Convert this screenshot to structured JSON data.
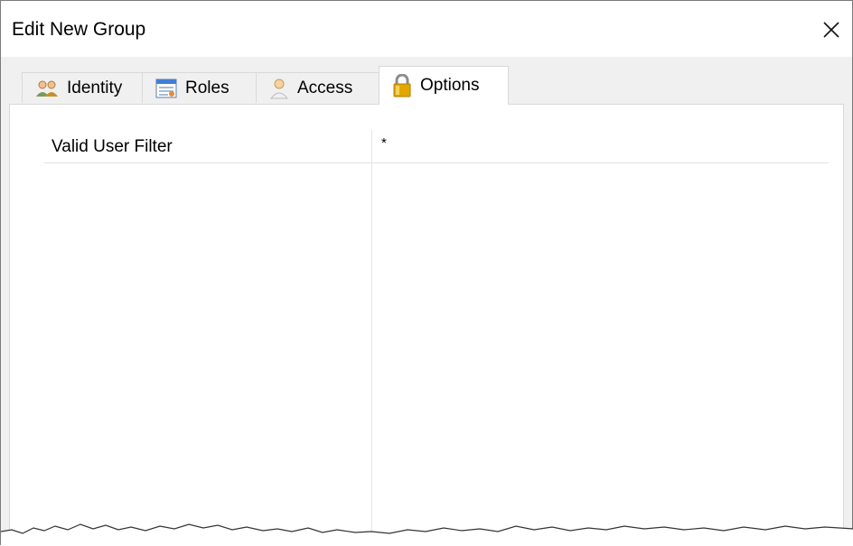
{
  "window": {
    "title": "Edit New Group"
  },
  "tabs": [
    {
      "label": "Identity",
      "icon": "users-icon"
    },
    {
      "label": "Roles",
      "icon": "roles-table-icon"
    },
    {
      "label": "Access",
      "icon": "person-icon"
    },
    {
      "label": "Options",
      "icon": "lock-icon",
      "active": true
    }
  ],
  "options": {
    "properties": [
      {
        "name": "Valid User Filter",
        "value": "*"
      }
    ]
  },
  "colors": {
    "lock": "#e0a800",
    "roles": "#3f7fd6",
    "access_skin": "#f1c48a"
  }
}
